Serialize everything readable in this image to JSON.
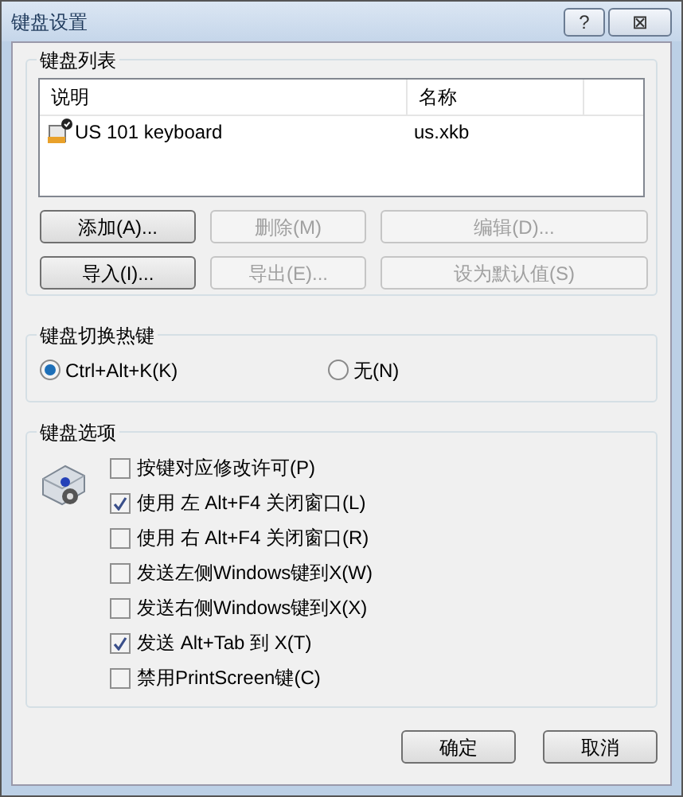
{
  "window": {
    "title": "键盘设置",
    "title_buttons": [
      "?",
      "⊠"
    ]
  },
  "keyboard_list": {
    "title": "键盘列表",
    "columns": [
      "说明",
      "名称"
    ],
    "rows": [
      {
        "description": "US 101 keyboard",
        "name": "us.xkb",
        "selected": false
      }
    ],
    "buttons": [
      {
        "label": "添加(A)...",
        "disabled": false
      },
      {
        "label": "删除(M)",
        "disabled": true
      },
      {
        "label": "编辑(D)...",
        "disabled": true
      },
      {
        "label": "导入(I)...",
        "disabled": false
      },
      {
        "label": "导出(E)...",
        "disabled": true
      },
      {
        "label": "设为默认值(S)",
        "disabled": true
      }
    ]
  },
  "hotkey": {
    "title": "键盘切换热键",
    "options": [
      {
        "label": "Ctrl+Alt+K(K)",
        "selected": true
      },
      {
        "label": "无(N)",
        "selected": false
      }
    ]
  },
  "options": {
    "title": "键盘选项",
    "items": [
      {
        "label": "按键对应修改许可(P)",
        "checked": false
      },
      {
        "label": "使用 左 Alt+F4 关闭窗口(L)",
        "checked": true
      },
      {
        "label": "使用 右 Alt+F4 关闭窗口(R)",
        "checked": false
      },
      {
        "label": "发送左侧Windows键到X(W)",
        "checked": false
      },
      {
        "label": "发送右侧Windows键到X(X)",
        "checked": false
      },
      {
        "label": "发送 Alt+Tab 到 X(T)",
        "checked": true
      },
      {
        "label": "禁用PrintScreen键(C)",
        "checked": false
      }
    ]
  },
  "buttons": [
    "确定",
    "取消"
  ]
}
